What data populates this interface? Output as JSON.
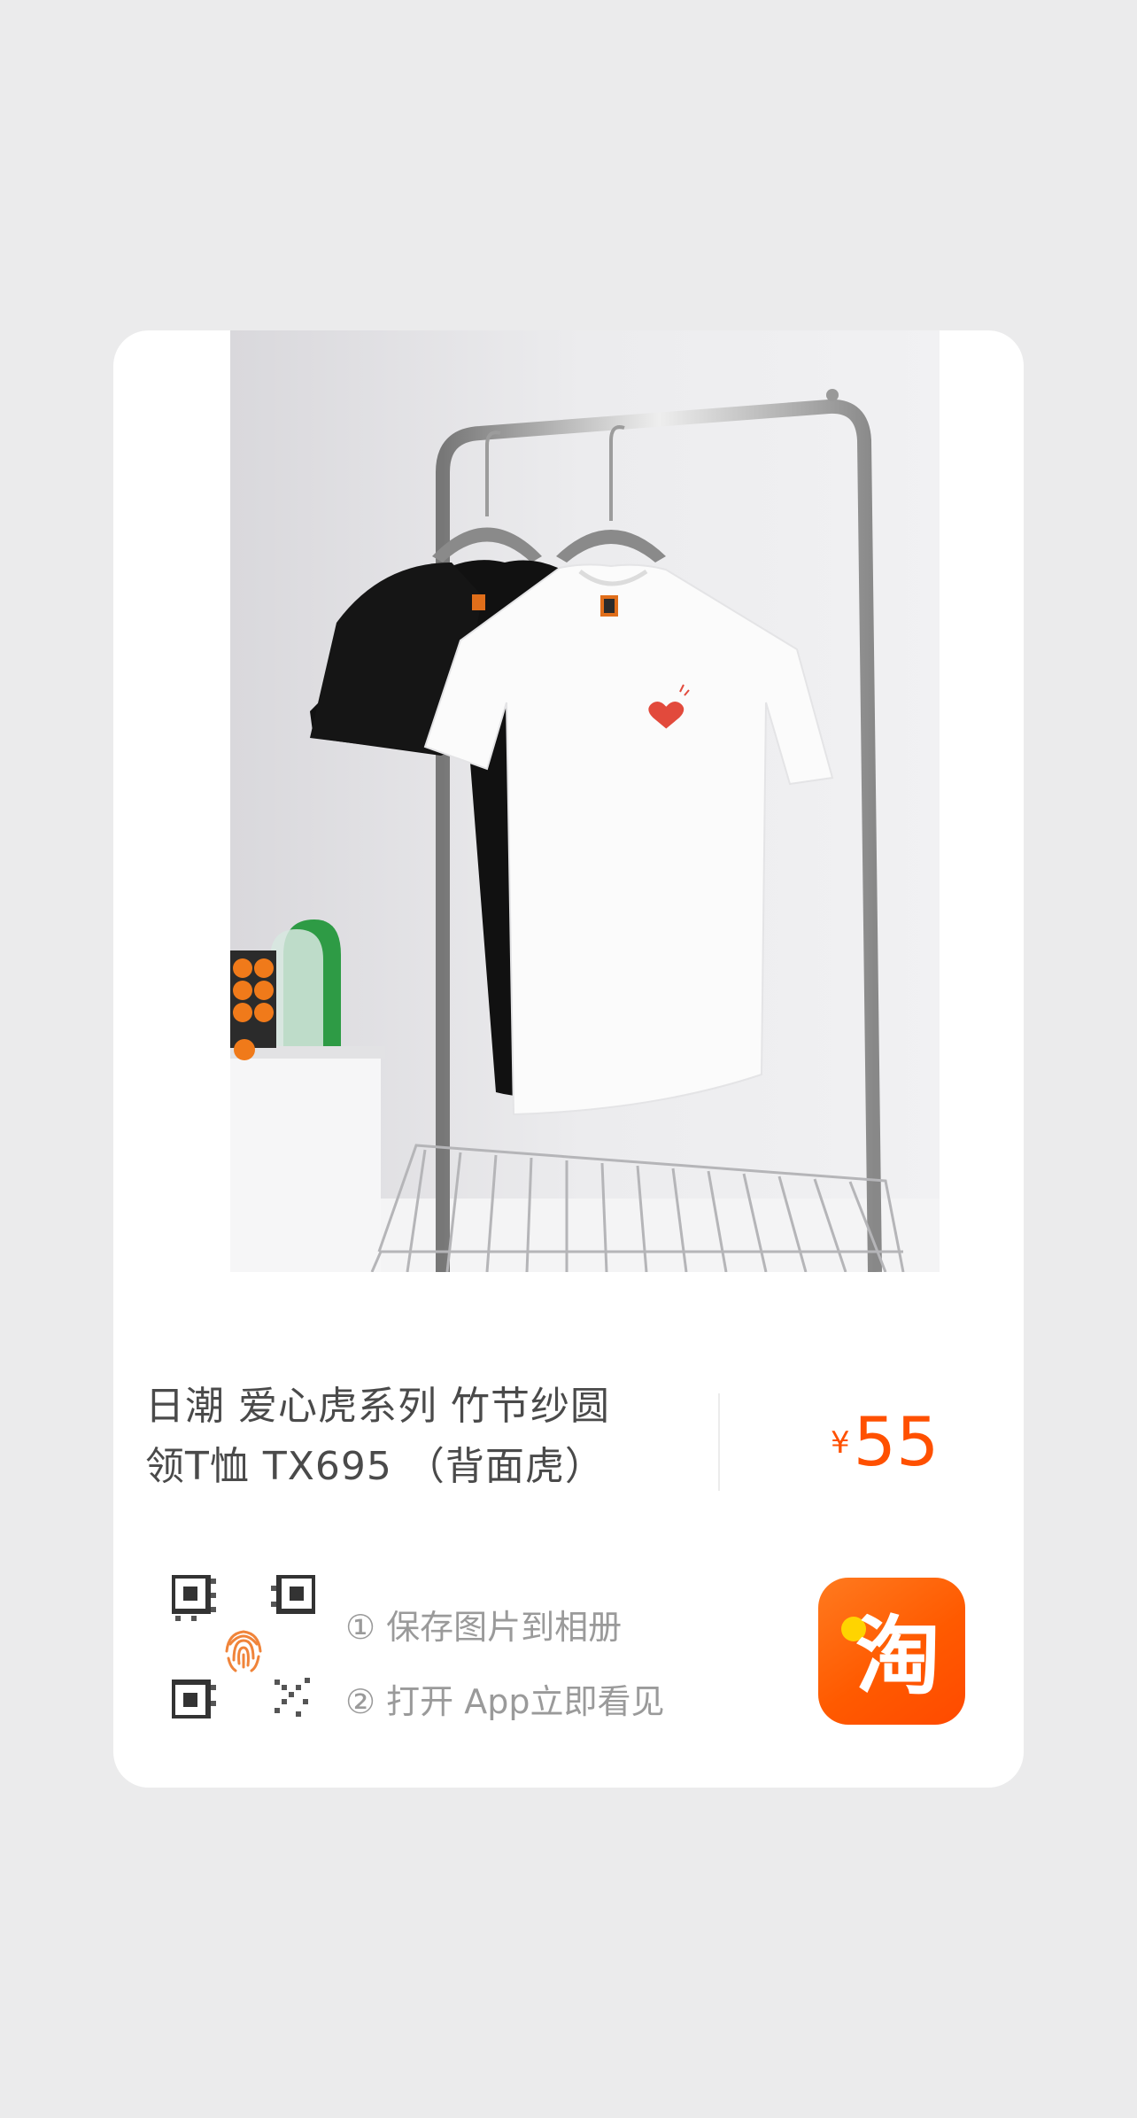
{
  "product": {
    "title_line1": "日潮  爱心虎系列 竹节纱圆",
    "title_line2": "领T恤 TX695 （背面虎）",
    "price_currency": "¥",
    "price_value": "55"
  },
  "share": {
    "step1": "① 保存图片到相册",
    "step2": "② 打开 App立即看见",
    "app_icon_char": "淘"
  },
  "colors": {
    "accent": "#ff5000",
    "background": "#ebebec"
  }
}
